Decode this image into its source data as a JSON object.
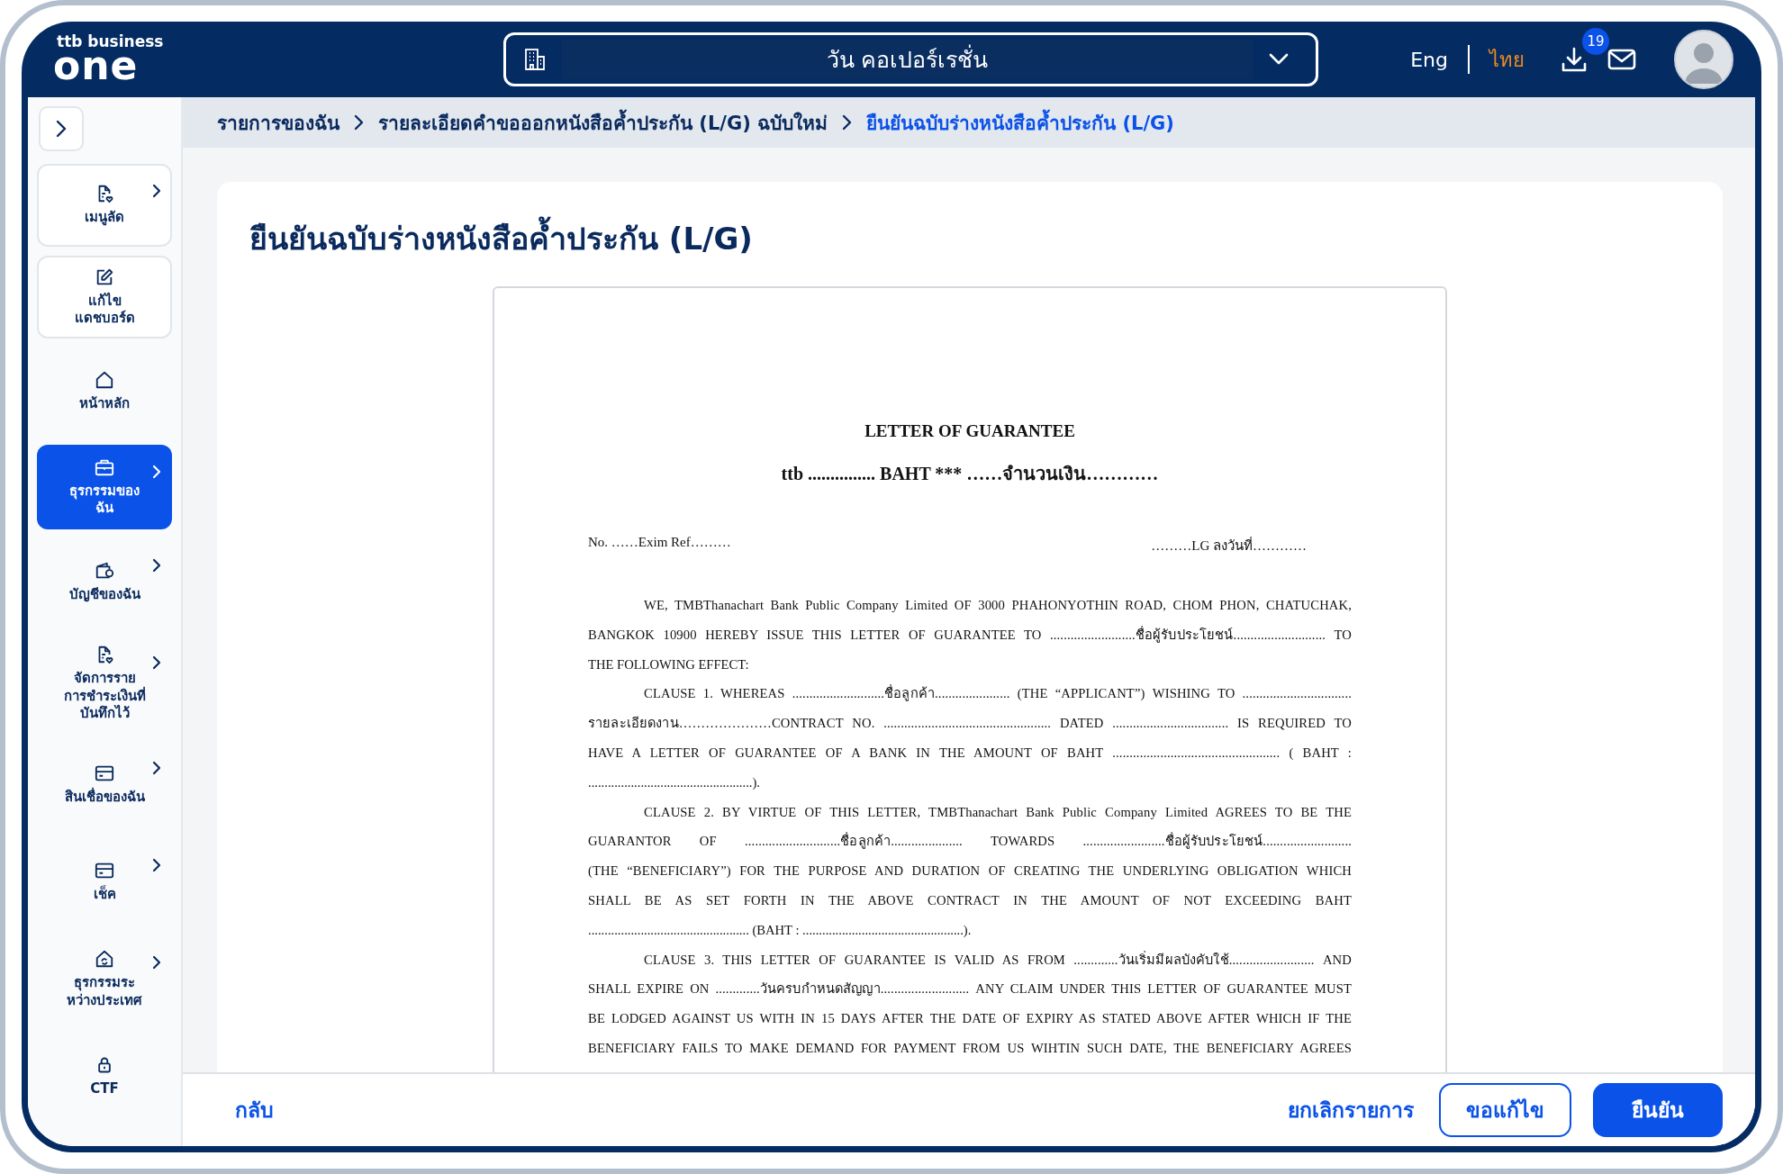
{
  "header": {
    "logo_small": "ttb business",
    "logo_big": "one",
    "company": "วัน คอเปอร์เรชั่น",
    "languages": [
      {
        "label": "Eng",
        "selected": false
      },
      {
        "label": "ไทย",
        "selected": true
      }
    ],
    "download_badge": "19"
  },
  "sidebar": {
    "items": [
      {
        "label": "เมนูลัด",
        "chevron": true,
        "boxed": true,
        "selected": false
      },
      {
        "label": "แก้ไข\nแดชบอร์ด",
        "chevron": false,
        "boxed": true,
        "selected": false
      },
      {
        "label": "หน้าหลัก",
        "chevron": false,
        "boxed": false,
        "selected": false
      },
      {
        "label": "ธุรกรรมของ\nฉัน",
        "chevron": true,
        "boxed": false,
        "selected": true
      },
      {
        "label": "บัญชีของฉัน",
        "chevron": true,
        "boxed": false,
        "selected": false
      },
      {
        "label": "จัดการราย\nการชำระเงินที่\nบันทึกไว้",
        "chevron": true,
        "boxed": false,
        "selected": false
      },
      {
        "label": "สินเชื่อของฉัน",
        "chevron": true,
        "boxed": false,
        "selected": false
      },
      {
        "label": "เช็ค",
        "chevron": true,
        "boxed": false,
        "selected": false
      },
      {
        "label": "ธุรกรรมระ\nหว่างประเทศ",
        "chevron": true,
        "boxed": false,
        "selected": false
      },
      {
        "label": "CTF",
        "chevron": false,
        "boxed": false,
        "selected": false
      }
    ]
  },
  "breadcrumb": [
    {
      "label": "รายการของฉัน",
      "selected": false
    },
    {
      "label": "รายละเอียดคำขอออกหนังสือค้ำประกัน (L/G) ฉบับใหม่",
      "selected": false
    },
    {
      "label": "ยืนยันฉบับร่างหนังสือค้ำประกัน (L/G)",
      "selected": true
    }
  ],
  "page_title": "ยืนยันฉบับร่างหนังสือค้ำประกัน (L/G)",
  "document": {
    "title": "LETTER OF GUARANTEE",
    "amount_line": "ttb ............... BAHT *** ……จำนวนเงิน…………",
    "ref_left": "No.   ……Exim Ref………",
    "ref_right": "………LG ลงวันที่…………",
    "lines": [
      {
        "text": "WE, TMBThanachart Bank Public Company Limited OF 3000 PHAHONYOTHIN ROAD, CHOM PHON, CHATUCHAK,",
        "indent": true,
        "justify": true
      },
      {
        "text": "BANGKOK 10900 HEREBY ISSUE THIS LETTER OF GUARANTEE TO .........................ชื่อผู้รับประโยชน์...........................   TO",
        "indent": false,
        "justify": true
      },
      {
        "text": "THE FOLLOWING EFFECT:",
        "indent": false,
        "justify": false
      },
      {
        "text": "CLAUSE 1. WHEREAS ...........................ชื่อลูกค้า...................... (THE “APPLICANT”) WISHING TO ................................",
        "indent": true,
        "justify": true
      },
      {
        "text": "รายละเอียดงาน…………………CONTRACT NO. ................................................. DATED .................................. IS REQUIRED TO",
        "indent": false,
        "justify": true
      },
      {
        "text": "HAVE A LETTER OF GUARANTEE OF A BANK IN THE AMOUNT OF BAHT ................................................. ( BAHT :",
        "indent": false,
        "justify": true
      },
      {
        "text": "..................................................).",
        "indent": false,
        "justify": false
      },
      {
        "text": "CLAUSE 2. BY VIRTUE OF THIS LETTER, TMBThanachart Bank Public Company Limited AGREES TO BE THE",
        "indent": true,
        "justify": true
      },
      {
        "text": "GUARANTOR OF ............................ชื่อลูกค้า..................... TOWARDS ........................ชื่อผู้รับประโยชน์..........................",
        "indent": false,
        "justify": true
      },
      {
        "text": "(THE “BENEFICIARY”) FOR THE PURPOSE AND DURATION OF CREATING THE UNDERLYING OBLIGATION WHICH",
        "indent": false,
        "justify": true
      },
      {
        "text": "SHALL BE AS SET FORTH IN THE ABOVE CONTRACT IN THE AMOUNT OF NOT EXCEEDING BAHT",
        "indent": false,
        "justify": true
      },
      {
        "text": "................................................. (BAHT : .................................................).",
        "indent": false,
        "justify": false
      },
      {
        "text": "CLAUSE 3. THIS LETTER OF GUARANTEE IS VALID AS FROM .............วันเริ่มมีผลบังคับใช้......................... AND",
        "indent": true,
        "justify": true
      },
      {
        "text": "SHALL EXPIRE ON .............วันครบกำหนดสัญญา.......................... ANY CLAIM UNDER THIS LETTER OF GUARANTEE MUST",
        "indent": false,
        "justify": true
      },
      {
        "text": "BE LODGED AGAINST US WITH IN 15 DAYS AFTER THE DATE OF EXPIRY AS STATED ABOVE AFTER WHICH IF THE",
        "indent": false,
        "justify": true
      },
      {
        "text": "BENEFICIARY FAILS TO MAKE DEMAND FOR PAYMENT FROM US WIHTIN SUCH DATE, THE BENEFICIARY AGREES",
        "indent": false,
        "justify": true
      }
    ]
  },
  "footer": {
    "back": "กลับ",
    "actions": [
      {
        "label": "ยกเลิกรายการ",
        "kind": "link"
      },
      {
        "label": "ขอแก้ไข",
        "kind": "outline"
      },
      {
        "label": "ยืนยัน",
        "kind": "primary"
      }
    ]
  }
}
